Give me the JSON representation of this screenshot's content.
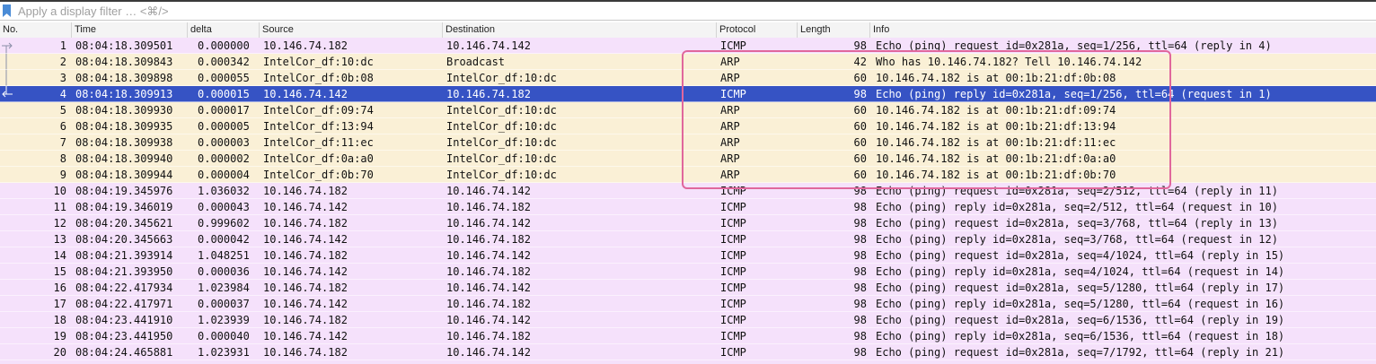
{
  "filter": {
    "placeholder": "Apply a display filter … <⌘/>"
  },
  "columns": {
    "no": "No.",
    "time": "Time",
    "delta": "delta",
    "source": "Source",
    "destination": "Destination",
    "protocol": "Protocol",
    "length": "Length",
    "info": "Info"
  },
  "colors": {
    "icmp_row": "#f5e1fb",
    "arp_row": "#faf0d6",
    "selected_row": "#3653c4",
    "highlight_box": "#e0679c",
    "bookmark": "#4a8bd6"
  },
  "packets": [
    {
      "no": "1",
      "time": "08:04:18.309501",
      "delta": "0.000000",
      "source": "10.146.74.182",
      "destination": "10.146.74.142",
      "protocol": "ICMP",
      "length": "98",
      "info": "Echo (ping) request  id=0x281a, seq=1/256, ttl=64 (reply in 4)",
      "kind": "icmp",
      "marker": "request-arrow"
    },
    {
      "no": "2",
      "time": "08:04:18.309843",
      "delta": "0.000342",
      "source": "IntelCor_df:10:dc",
      "destination": "Broadcast",
      "protocol": "ARP",
      "length": "42",
      "info": "Who has 10.146.74.182? Tell 10.146.74.142",
      "kind": "arp",
      "marker": "line"
    },
    {
      "no": "3",
      "time": "08:04:18.309898",
      "delta": "0.000055",
      "source": "IntelCor_df:0b:08",
      "destination": "IntelCor_df:10:dc",
      "protocol": "ARP",
      "length": "60",
      "info": "10.146.74.182 is at 00:1b:21:df:0b:08",
      "kind": "arp",
      "marker": "line"
    },
    {
      "no": "4",
      "time": "08:04:18.309913",
      "delta": "0.000015",
      "source": "10.146.74.142",
      "destination": "10.146.74.182",
      "protocol": "ICMP",
      "length": "98",
      "info": "Echo (ping) reply    id=0x281a, seq=1/256, ttl=64 (request in 1)",
      "kind": "selected",
      "marker": "reply-arrow"
    },
    {
      "no": "5",
      "time": "08:04:18.309930",
      "delta": "0.000017",
      "source": "IntelCor_df:09:74",
      "destination": "IntelCor_df:10:dc",
      "protocol": "ARP",
      "length": "60",
      "info": "10.146.74.182 is at 00:1b:21:df:09:74",
      "kind": "arp",
      "marker": "none"
    },
    {
      "no": "6",
      "time": "08:04:18.309935",
      "delta": "0.000005",
      "source": "IntelCor_df:13:94",
      "destination": "IntelCor_df:10:dc",
      "protocol": "ARP",
      "length": "60",
      "info": "10.146.74.182 is at 00:1b:21:df:13:94",
      "kind": "arp",
      "marker": "none"
    },
    {
      "no": "7",
      "time": "08:04:18.309938",
      "delta": "0.000003",
      "source": "IntelCor_df:11:ec",
      "destination": "IntelCor_df:10:dc",
      "protocol": "ARP",
      "length": "60",
      "info": "10.146.74.182 is at 00:1b:21:df:11:ec",
      "kind": "arp",
      "marker": "none"
    },
    {
      "no": "8",
      "time": "08:04:18.309940",
      "delta": "0.000002",
      "source": "IntelCor_df:0a:a0",
      "destination": "IntelCor_df:10:dc",
      "protocol": "ARP",
      "length": "60",
      "info": "10.146.74.182 is at 00:1b:21:df:0a:a0",
      "kind": "arp",
      "marker": "none"
    },
    {
      "no": "9",
      "time": "08:04:18.309944",
      "delta": "0.000004",
      "source": "IntelCor_df:0b:70",
      "destination": "IntelCor_df:10:dc",
      "protocol": "ARP",
      "length": "60",
      "info": "10.146.74.182 is at 00:1b:21:df:0b:70",
      "kind": "arp",
      "marker": "none"
    },
    {
      "no": "10",
      "time": "08:04:19.345976",
      "delta": "1.036032",
      "source": "10.146.74.182",
      "destination": "10.146.74.142",
      "protocol": "ICMP",
      "length": "98",
      "info": "Echo (ping) request  id=0x281a, seq=2/512, ttl=64 (reply in 11)",
      "kind": "icmp",
      "marker": "none"
    },
    {
      "no": "11",
      "time": "08:04:19.346019",
      "delta": "0.000043",
      "source": "10.146.74.142",
      "destination": "10.146.74.182",
      "protocol": "ICMP",
      "length": "98",
      "info": "Echo (ping) reply    id=0x281a, seq=2/512, ttl=64 (request in 10)",
      "kind": "icmp",
      "marker": "none"
    },
    {
      "no": "12",
      "time": "08:04:20.345621",
      "delta": "0.999602",
      "source": "10.146.74.182",
      "destination": "10.146.74.142",
      "protocol": "ICMP",
      "length": "98",
      "info": "Echo (ping) request  id=0x281a, seq=3/768, ttl=64 (reply in 13)",
      "kind": "icmp",
      "marker": "none"
    },
    {
      "no": "13",
      "time": "08:04:20.345663",
      "delta": "0.000042",
      "source": "10.146.74.142",
      "destination": "10.146.74.182",
      "protocol": "ICMP",
      "length": "98",
      "info": "Echo (ping) reply    id=0x281a, seq=3/768, ttl=64 (request in 12)",
      "kind": "icmp",
      "marker": "none"
    },
    {
      "no": "14",
      "time": "08:04:21.393914",
      "delta": "1.048251",
      "source": "10.146.74.182",
      "destination": "10.146.74.142",
      "protocol": "ICMP",
      "length": "98",
      "info": "Echo (ping) request  id=0x281a, seq=4/1024, ttl=64 (reply in 15)",
      "kind": "icmp",
      "marker": "none"
    },
    {
      "no": "15",
      "time": "08:04:21.393950",
      "delta": "0.000036",
      "source": "10.146.74.142",
      "destination": "10.146.74.182",
      "protocol": "ICMP",
      "length": "98",
      "info": "Echo (ping) reply    id=0x281a, seq=4/1024, ttl=64 (request in 14)",
      "kind": "icmp",
      "marker": "none"
    },
    {
      "no": "16",
      "time": "08:04:22.417934",
      "delta": "1.023984",
      "source": "10.146.74.182",
      "destination": "10.146.74.142",
      "protocol": "ICMP",
      "length": "98",
      "info": "Echo (ping) request  id=0x281a, seq=5/1280, ttl=64 (reply in 17)",
      "kind": "icmp",
      "marker": "none"
    },
    {
      "no": "17",
      "time": "08:04:22.417971",
      "delta": "0.000037",
      "source": "10.146.74.142",
      "destination": "10.146.74.182",
      "protocol": "ICMP",
      "length": "98",
      "info": "Echo (ping) reply    id=0x281a, seq=5/1280, ttl=64 (request in 16)",
      "kind": "icmp",
      "marker": "none"
    },
    {
      "no": "18",
      "time": "08:04:23.441910",
      "delta": "1.023939",
      "source": "10.146.74.182",
      "destination": "10.146.74.142",
      "protocol": "ICMP",
      "length": "98",
      "info": "Echo (ping) request  id=0x281a, seq=6/1536, ttl=64 (reply in 19)",
      "kind": "icmp",
      "marker": "none"
    },
    {
      "no": "19",
      "time": "08:04:23.441950",
      "delta": "0.000040",
      "source": "10.146.74.142",
      "destination": "10.146.74.182",
      "protocol": "ICMP",
      "length": "98",
      "info": "Echo (ping) reply    id=0x281a, seq=6/1536, ttl=64 (request in 18)",
      "kind": "icmp",
      "marker": "none"
    },
    {
      "no": "20",
      "time": "08:04:24.465881",
      "delta": "1.023931",
      "source": "10.146.74.182",
      "destination": "10.146.74.142",
      "protocol": "ICMP",
      "length": "98",
      "info": "Echo (ping) request  id=0x281a, seq=7/1792, ttl=64 (reply in 21)",
      "kind": "icmp",
      "marker": "none"
    },
    {
      "no": "21",
      "time": "",
      "delta": "",
      "source": "",
      "destination": "",
      "protocol": "",
      "length": "",
      "info": "",
      "kind": "icmp",
      "marker": "none"
    }
  ]
}
